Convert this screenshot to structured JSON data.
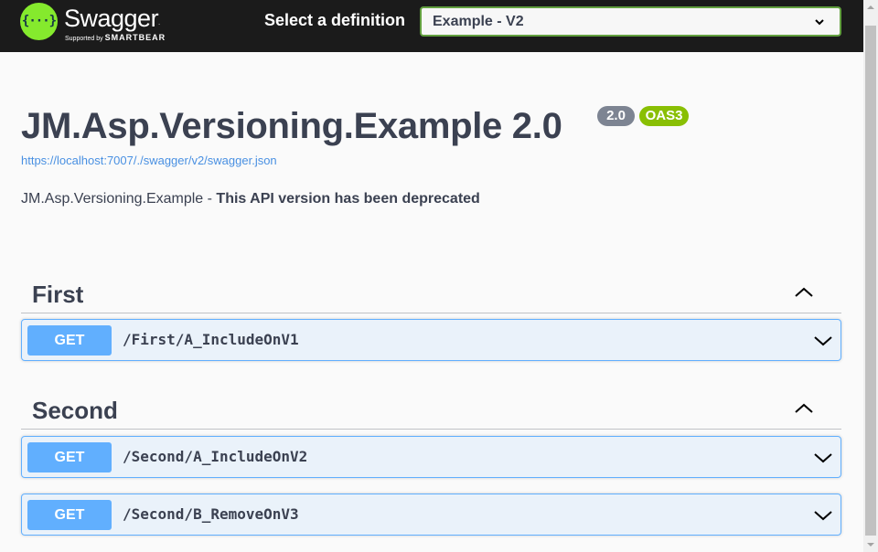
{
  "topbar": {
    "logo_glyph": "{···}",
    "logo_title": "Swagger",
    "logo_tm": ".",
    "logo_sub_prefix": "Supported by ",
    "logo_sub_brand": "SMARTBEAR",
    "definition_label": "Select a definition",
    "definition_value": "Example - V2",
    "definition_options": [
      "Example - V2"
    ],
    "colors": {
      "background": "#1b1b1b",
      "brand": "#85ea2d",
      "select_border": "#62a03f"
    }
  },
  "info": {
    "title": "JM.Asp.Versioning.Example 2.0",
    "version_badge": "2.0",
    "oas_badge": "OAS3",
    "url": "https://localhost:7007/./swagger/v2/swagger.json",
    "description_prefix": "JM.Asp.Versioning.Example - ",
    "description_bold": "This API version has been deprecated"
  },
  "tags": [
    {
      "name": "First",
      "expanded": true,
      "operations": [
        {
          "method": "GET",
          "path": "/First/A_IncludeOnV1"
        }
      ]
    },
    {
      "name": "Second",
      "expanded": true,
      "operations": [
        {
          "method": "GET",
          "path": "/Second/A_IncludeOnV2"
        },
        {
          "method": "GET",
          "path": "/Second/B_RemoveOnV3"
        }
      ]
    }
  ],
  "icons": {
    "select_arrow": "chevron-down-icon",
    "tag_toggle": "chevron-up-icon",
    "operation_toggle": "chevron-down-icon"
  },
  "colors": {
    "get_method": "#61affe",
    "oas_badge": "#89bf04",
    "version_badge": "#7d8492",
    "link": "#4990e2"
  }
}
